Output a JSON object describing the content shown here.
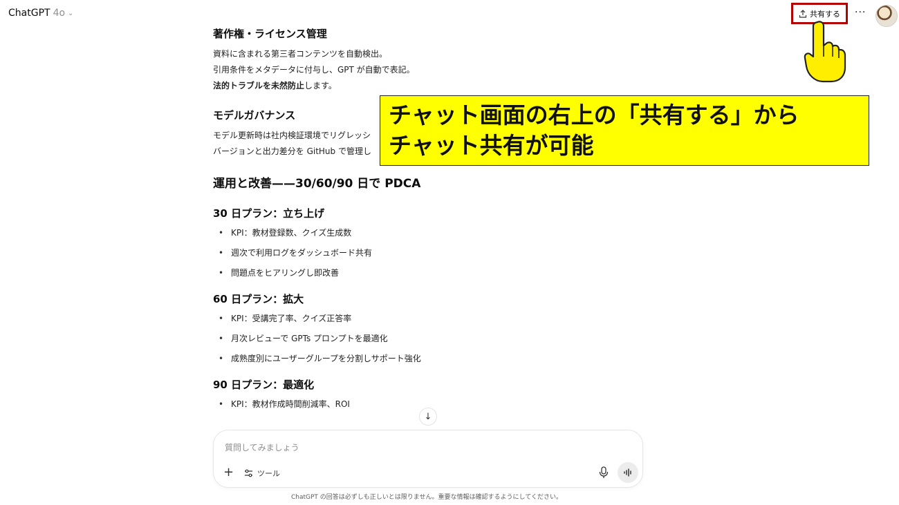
{
  "header": {
    "app_name": "ChatGPT",
    "model": "4o",
    "share_label": "共有する",
    "more_label": "···"
  },
  "content": {
    "section1_title": "著作権・ライセンス管理",
    "section1_lines": [
      "資料に含まれる第三者コンテンツを自動検出。",
      "引用条件をメタデータに付与し、GPT が自動で表記。"
    ],
    "section1_bold": "法的トラブルを未然防止",
    "section1_tail": "します。",
    "section2_title": "モデルガバナンス",
    "section2_lines": [
      "モデル更新時は社内検証環境でリグレッシ",
      "バージョンと出力差分を GitHub で管理し"
    ],
    "main_heading": "運用と改善——30/60/90 日で PDCA",
    "plan30_title": "30 日プラン：立ち上げ",
    "plan30_items": [
      "KPI：教材登録数、クイズ生成数",
      "週次で利用ログをダッシュボード共有",
      "問題点をヒアリングし即改善"
    ],
    "plan60_title": "60 日プラン：拡大",
    "plan60_items": [
      "KPI：受講完了率、クイズ正答率",
      "月次レビューで GPTs プロンプトを最適化",
      "成熟度別にユーザーグループを分割しサポート強化"
    ],
    "plan90_title": "90 日プラン：最適化",
    "plan90_items": [
      "KPI：教材作成時間削減率、ROI"
    ]
  },
  "callout": {
    "line1": "チャット画面の右上の「共有する」から",
    "line2": "チャット共有が可能",
    "color": "#ffff00"
  },
  "composer": {
    "placeholder": "質問してみましょう",
    "tools_label": "ツール"
  },
  "footer": {
    "note": "ChatGPT の回答は必ずしも正しいとは限りません。重要な情報は確認するようにしてください。"
  },
  "colors": {
    "highlight_border": "#b30000",
    "hand": "#ffee00"
  }
}
